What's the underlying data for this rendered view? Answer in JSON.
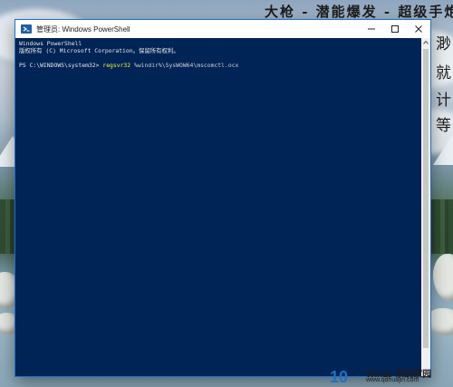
{
  "window": {
    "title": "管理员: Windows PowerShell",
    "minimize_label": "minimize",
    "maximize_label": "maximize",
    "close_label": "close"
  },
  "console": {
    "line1": "Windows PowerShell",
    "line2": "版权所有 (C) Microsoft Corporation。保留所有权利。",
    "prompt": "PS C:\\WINDOWS\\system32> ",
    "command": "regsvr32",
    "argument": " %windir%\\SysWOW64\\mscomctl.ocx"
  },
  "wallpaper": {
    "top_text": "大枪 - 潜能爆发 - 超级手炮 -",
    "side_chars": [
      "渺",
      "就",
      "计",
      "等"
    ]
  },
  "watermark": {
    "logo": "10",
    "brand": "Win10 系统家园",
    "url": "www.qdhuajin.com"
  },
  "colors": {
    "console_bg": "#012456",
    "command_color": "#f5f543"
  }
}
